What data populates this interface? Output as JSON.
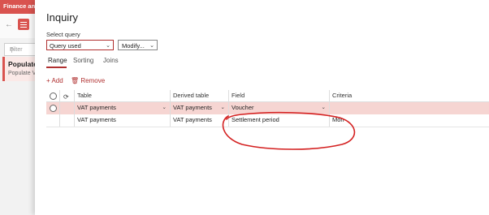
{
  "background_app": {
    "title": "Finance and",
    "filter_placeholder": "Filter",
    "card_title": "Populate",
    "card_subtitle": "Populate V"
  },
  "dialog": {
    "title": "Inquiry",
    "select_query_label": "Select query",
    "query_value": "Query used",
    "modify_label": "Modify...",
    "tabs": [
      {
        "label": "Range",
        "active": true
      },
      {
        "label": "Sorting",
        "active": false
      },
      {
        "label": "Joins",
        "active": false
      }
    ],
    "actions": {
      "add": "Add",
      "remove": "Remove"
    },
    "grid": {
      "columns": [
        "Table",
        "Derived table",
        "Field",
        "Criteria"
      ],
      "rows": [
        {
          "table": "VAT payments",
          "derived_table": "VAT payments",
          "field": "Voucher",
          "criteria": "",
          "selected": true
        },
        {
          "table": "VAT payments",
          "derived_table": "VAT payments",
          "field": "Settlement period",
          "criteria": "Mon",
          "selected": false
        }
      ]
    }
  },
  "colors": {
    "accent": "#b03030",
    "selected_row": "#f6d5d2",
    "annotation": "#d42020"
  },
  "icons": [
    "back-arrow-icon",
    "hamburger-menu-icon",
    "search-icon",
    "chevron-down-icon",
    "plus-icon",
    "trash-icon",
    "radio-icon",
    "refresh-icon"
  ]
}
